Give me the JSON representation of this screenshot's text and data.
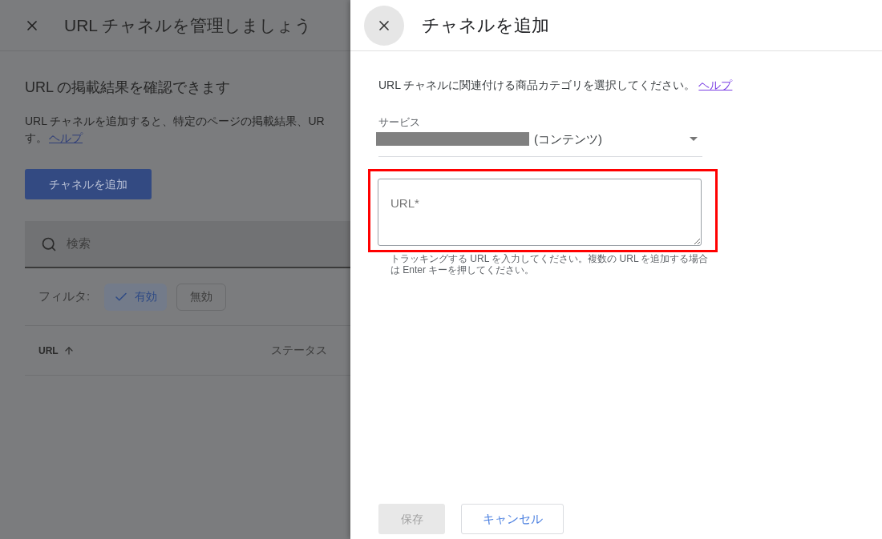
{
  "background_page": {
    "title": "URL チャネルを管理しましょう",
    "heading": "URL の掲載結果を確認できます",
    "description_line1": "URL チャネルを追加すると、特定のページの掲載結果、UR",
    "description_line2": "す。",
    "help_link": "ヘルプ",
    "add_button": "チャネルを追加",
    "search": {
      "placeholder": "検索"
    },
    "filter_label": "フィルタ:",
    "filters": [
      {
        "label": "有効",
        "selected": true
      },
      {
        "label": "無効",
        "selected": false
      }
    ],
    "columns": [
      {
        "label": "URL",
        "sorted": true
      },
      {
        "label": "ステータス",
        "sorted": false
      }
    ]
  },
  "dialog": {
    "title": "チャネルを追加",
    "instruction": "URL チャネルに関連付ける商品カテゴリを選択してください。",
    "help_link": "ヘルプ",
    "service": {
      "label": "サービス",
      "value": "(コンテンツ)",
      "redacted": true
    },
    "url_field": {
      "placeholder": "URL*",
      "hint": "トラッキングする URL を入力してください。複数の URL を追加する場合は Enter キーを押してください。",
      "highlighted": true
    },
    "save_button": {
      "label": "保存",
      "disabled": true
    },
    "cancel_button": "キャンセル"
  }
}
